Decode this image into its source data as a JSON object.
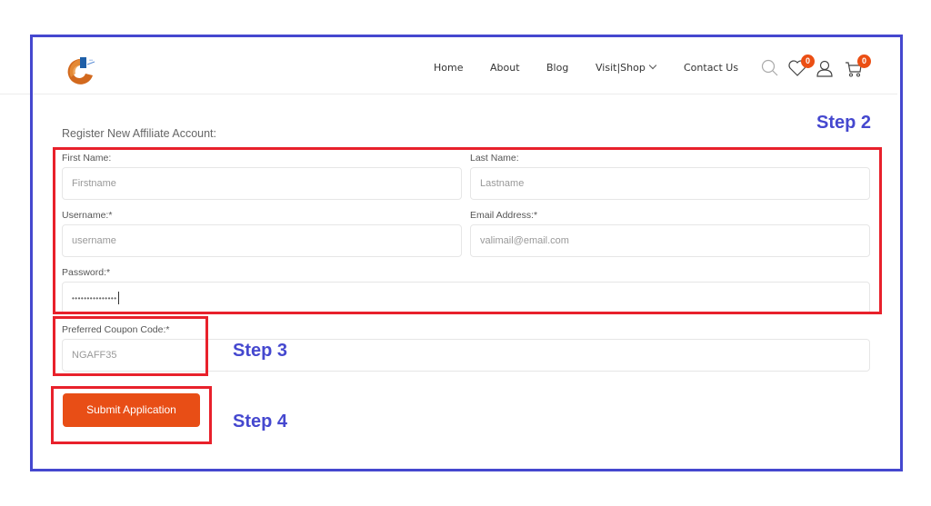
{
  "header": {
    "logo_alt": "site-logo",
    "nav": [
      {
        "label": "Home"
      },
      {
        "label": "About"
      },
      {
        "label": "Blog"
      },
      {
        "label": "Visit|Shop",
        "has_dropdown": true
      },
      {
        "label": "Contact Us"
      }
    ],
    "icons": {
      "search": "search-icon",
      "wishlist": "heart-icon",
      "account": "user-icon",
      "cart": "cart-icon"
    },
    "wishlist_count": "0",
    "cart_count": "0"
  },
  "form": {
    "title": "Register New Affiliate Account:",
    "fields": {
      "first_name": {
        "label": "First Name:",
        "placeholder": "Firstname",
        "value": ""
      },
      "last_name": {
        "label": "Last Name:",
        "placeholder": "Lastname",
        "value": ""
      },
      "username": {
        "label": "Username:*",
        "placeholder": "username",
        "value": ""
      },
      "email": {
        "label": "Email Address:*",
        "placeholder": "valimail@email.com",
        "value": ""
      },
      "password": {
        "label": "Password:*",
        "value": "•••••••••••••••"
      },
      "coupon": {
        "label": "Preferred Coupon Code:*",
        "placeholder": "NGAFF35",
        "value": ""
      }
    },
    "submit_label": "Submit Application"
  },
  "annotations": {
    "step2": "Step 2",
    "step3": "Step 3",
    "step4": "Step 4"
  },
  "colors": {
    "accent": "#e84e16",
    "annotation_blue": "#4548cf",
    "annotation_red": "#e8212b"
  }
}
